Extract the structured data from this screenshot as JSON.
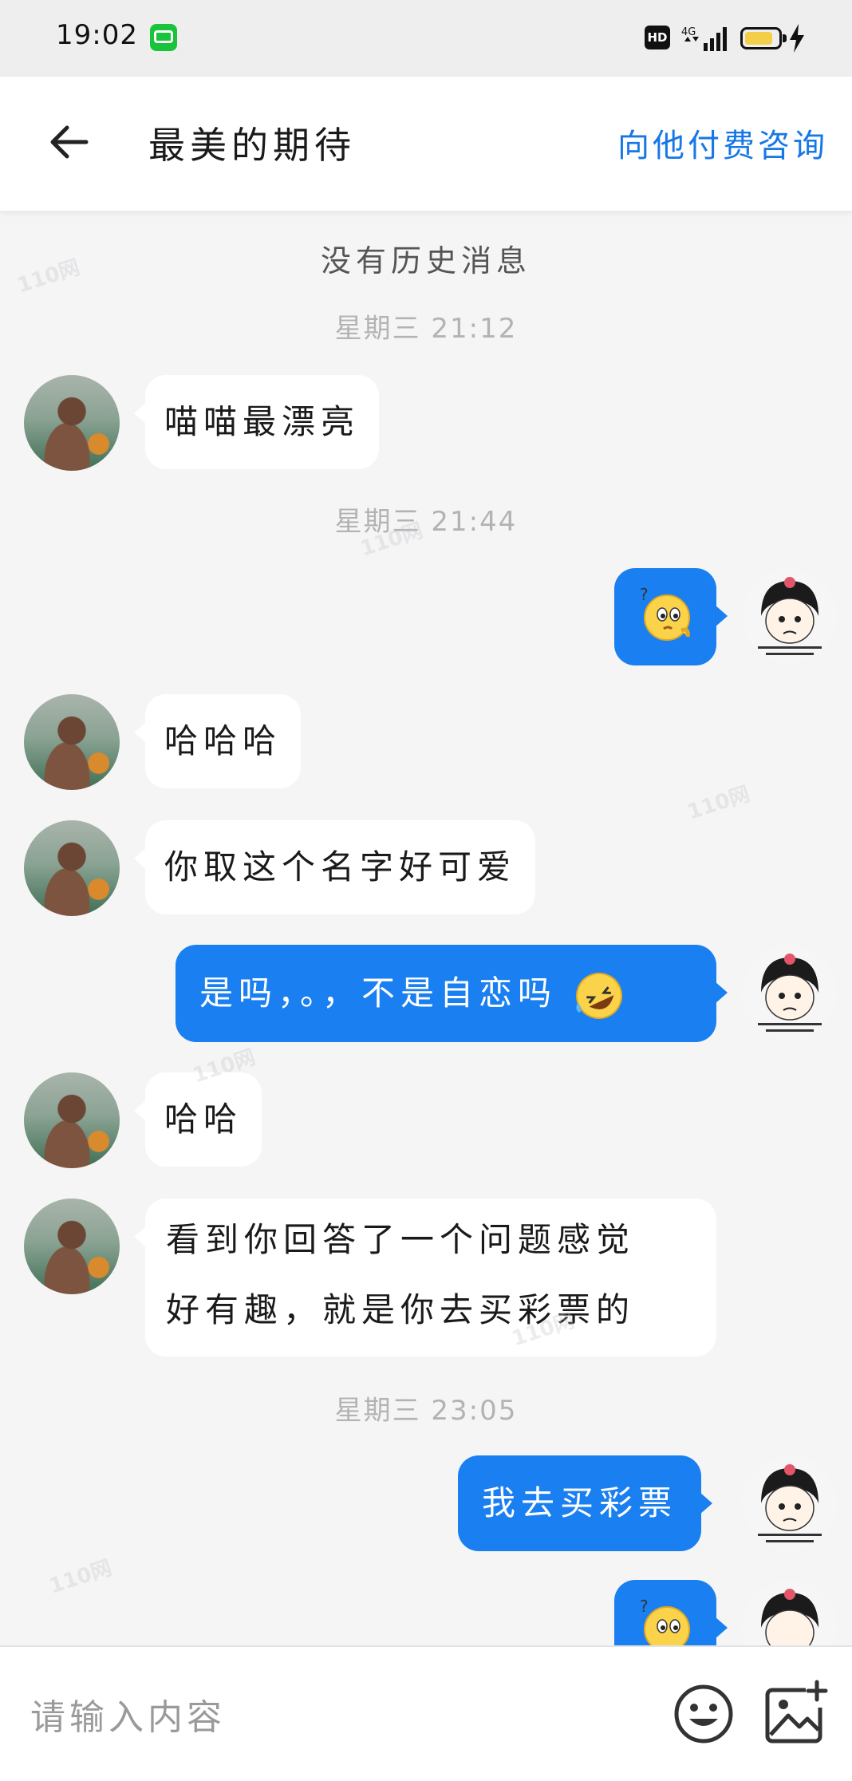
{
  "status_bar": {
    "time": "19:02",
    "network": "4G",
    "hd": "HD"
  },
  "header": {
    "title": "最美的期待",
    "action": "向他付费咨询"
  },
  "chat": {
    "history_note": "没有历史消息",
    "timestamps": [
      "星期三 21:12",
      "星期三 21:44",
      "星期三 23:05"
    ],
    "messages": [
      {
        "side": "left",
        "text": "喵喵最漂亮"
      },
      {
        "side": "right",
        "emoji": "thinking-face-emoji"
      },
      {
        "side": "left",
        "text": "哈哈哈"
      },
      {
        "side": "left",
        "text": "你取这个名字好可爱"
      },
      {
        "side": "right",
        "text": "是吗，。，不是自恋吗",
        "emoji": "rolling-laughing-emoji"
      },
      {
        "side": "left",
        "text": "哈哈"
      },
      {
        "side": "left",
        "line1": "看到你回答了一个问题感觉",
        "line2": "好有趣，就是你去买彩票的"
      },
      {
        "side": "right",
        "text": "我去买彩票"
      },
      {
        "side": "right",
        "emoji": "thinking-face-emoji"
      }
    ]
  },
  "input_bar": {
    "placeholder": "请输入内容"
  },
  "watermark": "110网",
  "colors": {
    "accent": "#1a7ff0",
    "header_action": "#1677e6",
    "background": "#f5f5f5"
  }
}
